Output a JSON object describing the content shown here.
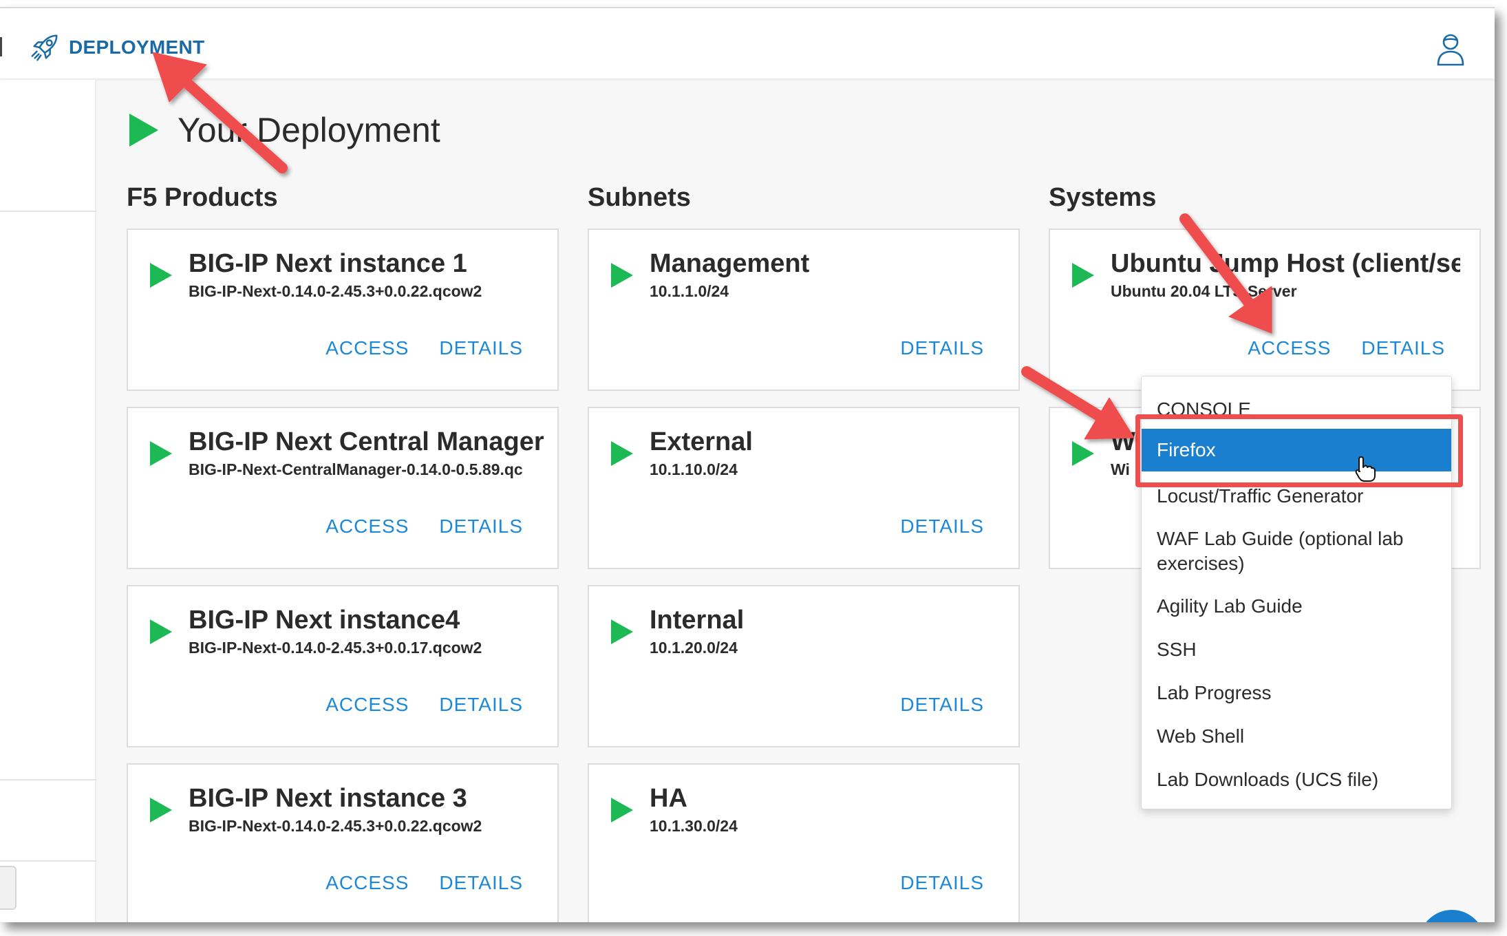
{
  "header": {
    "brand_label": "DEPLOYMENT",
    "brand_icon": "rocket-icon",
    "user_icon": "user-icon"
  },
  "page": {
    "title": "Your Deployment"
  },
  "sections": {
    "products": "F5 Products",
    "subnets": "Subnets",
    "systems": "Systems"
  },
  "products": [
    {
      "name": "BIG-IP Next instance 1",
      "image": "BIG-IP-Next-0.14.0-2.45.3+0.0.22.qcow2",
      "access": "ACCESS",
      "details": "DETAILS"
    },
    {
      "name": "BIG-IP Next Central Manager",
      "image": "BIG-IP-Next-CentralManager-0.14.0-0.5.89.qc",
      "access": "ACCESS",
      "details": "DETAILS"
    },
    {
      "name": "BIG-IP Next instance4",
      "image": "BIG-IP-Next-0.14.0-2.45.3+0.0.17.qcow2",
      "access": "ACCESS",
      "details": "DETAILS"
    },
    {
      "name": "BIG-IP Next instance 3",
      "image": "BIG-IP-Next-0.14.0-2.45.3+0.0.22.qcow2",
      "access": "ACCESS",
      "details": "DETAILS"
    }
  ],
  "subnets": [
    {
      "name": "Management",
      "cidr": "10.1.1.0/24",
      "details": "DETAILS"
    },
    {
      "name": "External",
      "cidr": "10.1.10.0/24",
      "details": "DETAILS"
    },
    {
      "name": "Internal",
      "cidr": "10.1.20.0/24",
      "details": "DETAILS"
    },
    {
      "name": "HA",
      "cidr": "10.1.30.0/24",
      "details": "DETAILS"
    }
  ],
  "systems": [
    {
      "name": "Ubuntu Jump Host (client/server)",
      "os": "Ubuntu 20.04 LTS Server",
      "access": "ACCESS",
      "details": "DETAILS"
    },
    {
      "name": "W",
      "os": "Wi"
    }
  ],
  "access_menu": {
    "items": [
      "CONSOLE",
      "Firefox",
      "Locust/Traffic Generator",
      "WAF Lab Guide (optional lab exercises)",
      "Agility Lab Guide",
      "SSH",
      "Lab Progress",
      "Web Shell",
      "Lab Downloads (UCS file)"
    ],
    "selected": "Firefox"
  },
  "colors": {
    "accent": "#1e88d8",
    "play_green": "#1db954",
    "annotation_red": "#ef4e4e",
    "menu_selected": "#1b7fd0"
  }
}
